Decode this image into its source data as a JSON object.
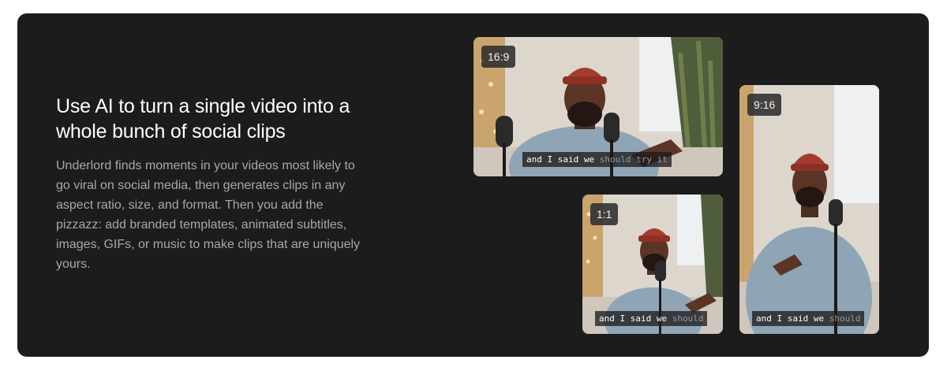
{
  "feature": {
    "title": "Use AI to turn a single video into a whole bunch of social clips",
    "description": "Underlord finds moments in your videos most likely to go viral on social media, then generates clips in any aspect ratio, size, and format. Then you add the pizzazz: add branded templates, animated subtitles, images, GIFs, or music to make clips that are uniquely yours."
  },
  "clips": [
    {
      "ratio": "16:9",
      "subtitle_said": "and I said we",
      "subtitle_rest": " should try it"
    },
    {
      "ratio": "1:1",
      "subtitle_said": "and I said we",
      "subtitle_rest": " should"
    },
    {
      "ratio": "9:16",
      "subtitle_said": "and I said we",
      "subtitle_rest": " should"
    }
  ],
  "colors": {
    "card_background": "#1c1c1c",
    "title": "#ffffff",
    "body_text": "#a8a8a8",
    "badge_background": "#2d2d2d"
  }
}
